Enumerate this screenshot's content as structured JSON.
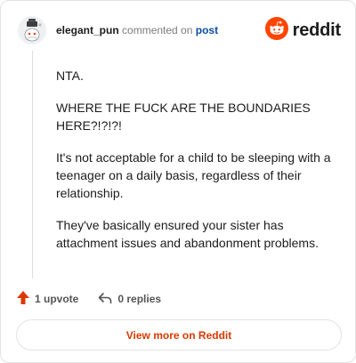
{
  "header": {
    "username": "elegant_pun",
    "commented_on": "commented on",
    "post_link": "post",
    "brand": "reddit"
  },
  "comment": {
    "paragraphs": [
      "NTA.",
      "WHERE THE FUCK ARE THE BOUNDARIES HERE?!?!?!",
      "It's not acceptable for a child to be sleeping with a teenager on a daily basis, regardless of their relationship.",
      "They've basically ensured your sister has attachment issues and abandonment problems."
    ]
  },
  "actions": {
    "upvote_label": "1 upvote",
    "replies_label": "0 replies"
  },
  "footer": {
    "view_more_label": "View more on Reddit"
  },
  "icons": {
    "avatar": "snoo-avatar-icon",
    "brand": "reddit-logo-icon",
    "upvote": "upvote-arrow-icon",
    "reply": "reply-arrow-icon"
  },
  "colors": {
    "brand_orange": "#ff4500",
    "upvote_orange": "#d93900",
    "link_blue": "#0a4ea3",
    "view_more_text": "#d93900"
  }
}
